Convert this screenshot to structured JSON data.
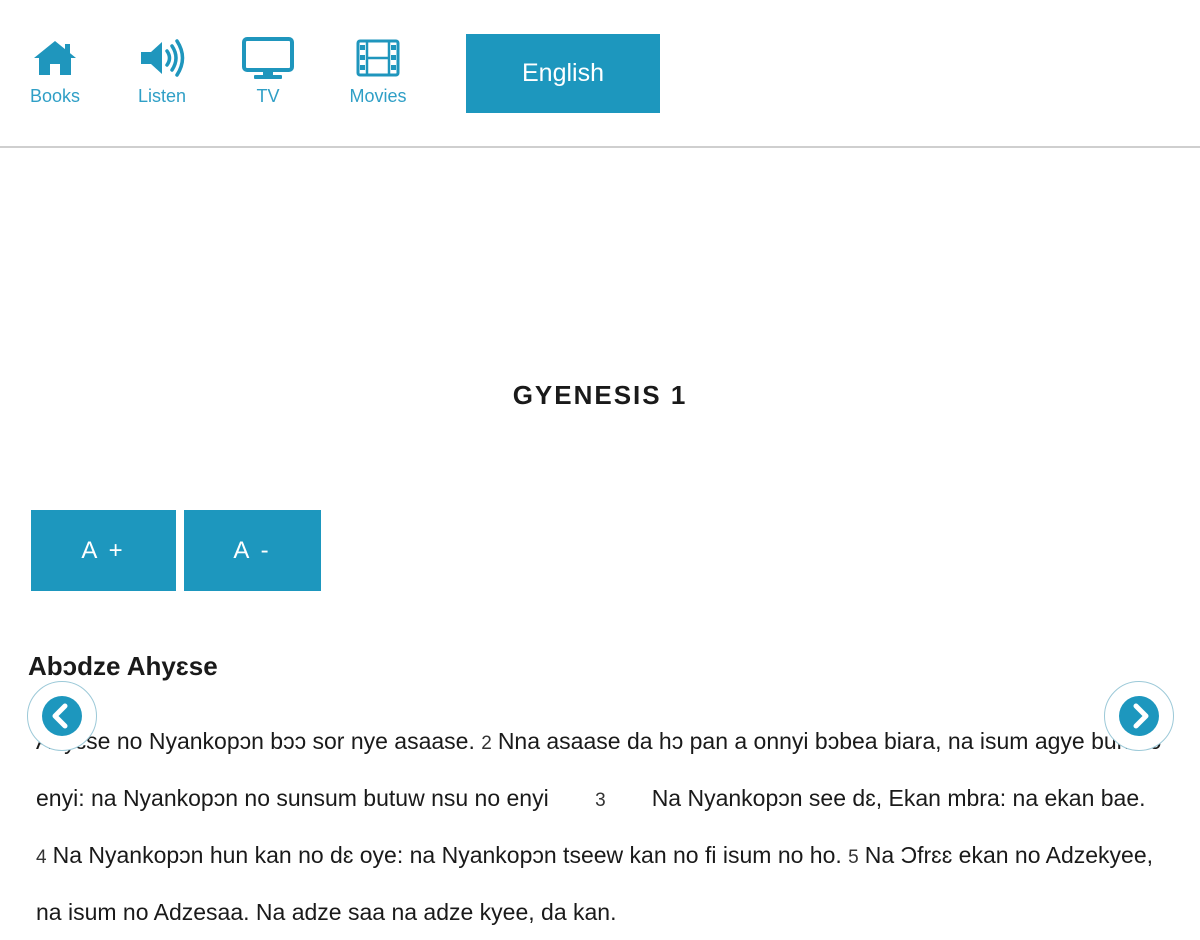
{
  "nav": {
    "items": [
      {
        "id": "books",
        "label": "Books",
        "icon": "home-icon"
      },
      {
        "id": "listen",
        "label": "Listen",
        "icon": "speaker-icon"
      },
      {
        "id": "tv",
        "label": "TV",
        "icon": "monitor-icon"
      },
      {
        "id": "movies",
        "label": "Movies",
        "icon": "film-icon"
      }
    ],
    "language_button": "English"
  },
  "chapter": {
    "title": "GYENESIS 1",
    "font_increase_label": "A +",
    "font_decrease_label": "A -",
    "section_heading": "Abɔdze Ahyɛse",
    "verses": [
      {
        "num": "",
        "text": "Ahyɛse no Nyankopɔn bɔɔ sor nye asaase."
      },
      {
        "num": "2",
        "text": "Nna asaase da hɔ pan a onnyi bɔbea biara, na isum agye bun no enyi: na Nyankopɔn no sunsum butuw nsu no enyi"
      },
      {
        "num": "3",
        "text": "Na Nyankopɔn see dɛ, Ekan mbra: na ekan bae."
      },
      {
        "num": "4",
        "text": "Na Nyankopɔn hun kan no dɛ oye: na Nyankopɔn tseew kan no fi isum no ho."
      },
      {
        "num": "5",
        "text": "Na Ɔfrɛɛ ekan no Adzekyee, na isum no Adzesaa. Na adze saa na adze kyee, da kan."
      }
    ]
  },
  "colors": {
    "accent": "#1d97be",
    "nav_label": "#2f9fc6",
    "text": "#1a1a1a",
    "divider": "#cfcfcf"
  },
  "controls": {
    "prev_icon": "chevron-left-icon",
    "next_icon": "chevron-right-icon"
  }
}
